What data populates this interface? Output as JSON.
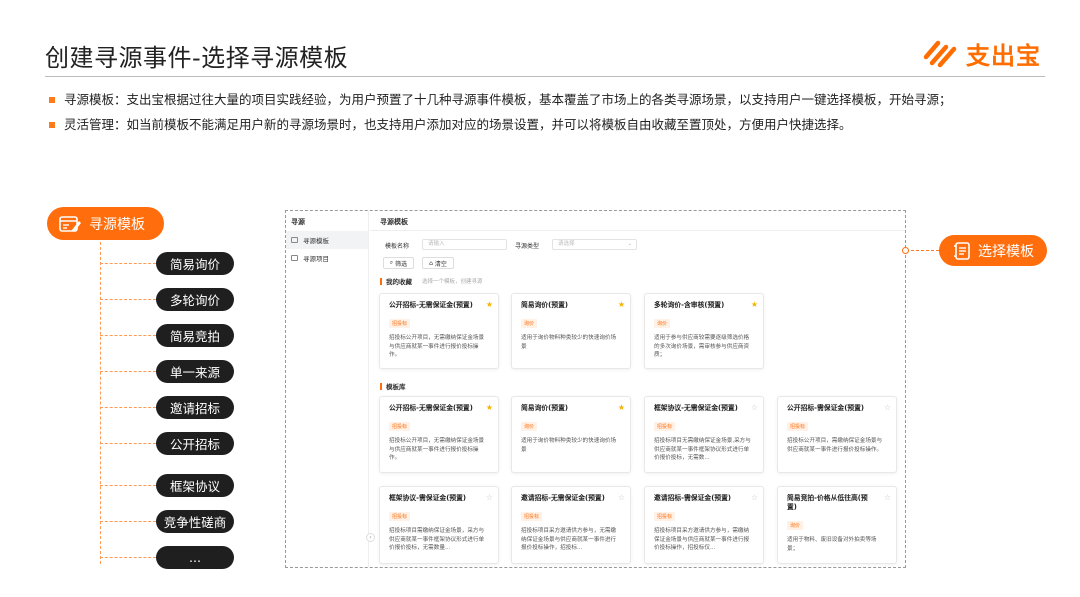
{
  "title": "创建寻源事件-选择寻源模板",
  "logo": {
    "text": "支出宝",
    "color": "#ff6d00",
    "icon": "zhichubao-logo-icon"
  },
  "bullets": [
    "寻源模板：支出宝根据过往大量的项目实践经验，为用户预置了十几种寻源事件模板，基本覆盖了市场上的各类寻源场景，以支持用户一键选择模板，开始寻源；",
    "灵活管理：如当前模板不能满足用户新的寻源场景时，也支持用户添加对应的场景设置，并可以将模板自由收藏至置顶处，方便用户快捷选择。"
  ],
  "accent_color": "#ff6d0c",
  "left_panel": {
    "label": "寻源模板",
    "types": [
      "简易询价",
      "多轮询价",
      "简易竞拍",
      "单一来源",
      "邀请招标",
      "公开招标",
      "框架协议",
      "竞争性磋商",
      "..."
    ]
  },
  "right_callout": {
    "label": "选择模板"
  },
  "app": {
    "sidebar": {
      "title": "寻源",
      "items": [
        {
          "label": "寻源模板",
          "active": true
        },
        {
          "label": "寻源项目",
          "active": false
        }
      ]
    },
    "header": "寻源模板",
    "filters": {
      "name_label": "模板名称",
      "name_placeholder": "请输入",
      "type_label": "寻源类型",
      "type_placeholder": "请选择",
      "search_btn": "筛选",
      "clear_btn": "清空"
    },
    "favorites": {
      "title": "我的收藏",
      "note": "选择一个模板，创建寻源",
      "cards": [
        {
          "title": "公开招标-无需保证金(预置)",
          "tag": "招投标",
          "desc": "招投标公开项目，无需缴纳保证金场景与供应商就某一事件进行报价投标操作。",
          "starred": true
        },
        {
          "title": "简易询价(预置)",
          "tag": "询价",
          "desc": "适用于询价物料种类较少的快速询价场景",
          "starred": true
        },
        {
          "title": "多轮询价-含审核(预置)",
          "tag": "询价",
          "desc": "适用于参与供应商较需要逐级筛选价格的多次询价场景，需审核参与供应商资质；",
          "starred": true
        }
      ]
    },
    "library": {
      "title": "模板库",
      "cards": [
        {
          "title": "公开招标-无需保证金(预置)",
          "tag": "招投标",
          "desc": "招投标公开项目，无需缴纳保证金场景与供应商就某一事件进行报价投标操作。",
          "starred": true
        },
        {
          "title": "简易询价(预置)",
          "tag": "询价",
          "desc": "适用于询价物料种类较少的快速询价场景",
          "starred": true
        },
        {
          "title": "框架协议-无需保证金(预置)",
          "tag": "招投标",
          "desc": "招投标项目无需缴纳保证金场景,采方与供应商就某一事件框架协议形式进行单价报价投标，无需数...",
          "starred": false
        },
        {
          "title": "公开招标-需保证金(预置)",
          "tag": "招投标",
          "desc": "招投标公开项目，需缴纳保证金场景与供应商就某一事件进行报价投标操作。",
          "starred": false
        },
        {
          "title": "框架协议-需保证金(预置)",
          "tag": "招投标",
          "desc": "招投标项目需缴纳保证金场景，采方与供应商就某一事件框架协议形式进行单价报价投标，无需数量...",
          "starred": false
        },
        {
          "title": "邀请招标-无需保证金(预置)",
          "tag": "招投标",
          "desc": "招投标项目采方邀请供方参与，无需缴纳保证金场景与供应商就某一事件进行报价投标操作，招投标...",
          "starred": false
        },
        {
          "title": "邀请招标-需保证金(预置)",
          "tag": "招投标",
          "desc": "招投标项目采方邀请供方参与，需缴纳保证金场景与供应商就某一事件进行报价投标操作，招投标仅...",
          "starred": false
        },
        {
          "title": "简易竞拍-价格从低往高(预置)",
          "tag": "询价",
          "desc": "适用于物料、废旧设备对外拍卖等场景；",
          "starred": false
        }
      ]
    }
  }
}
